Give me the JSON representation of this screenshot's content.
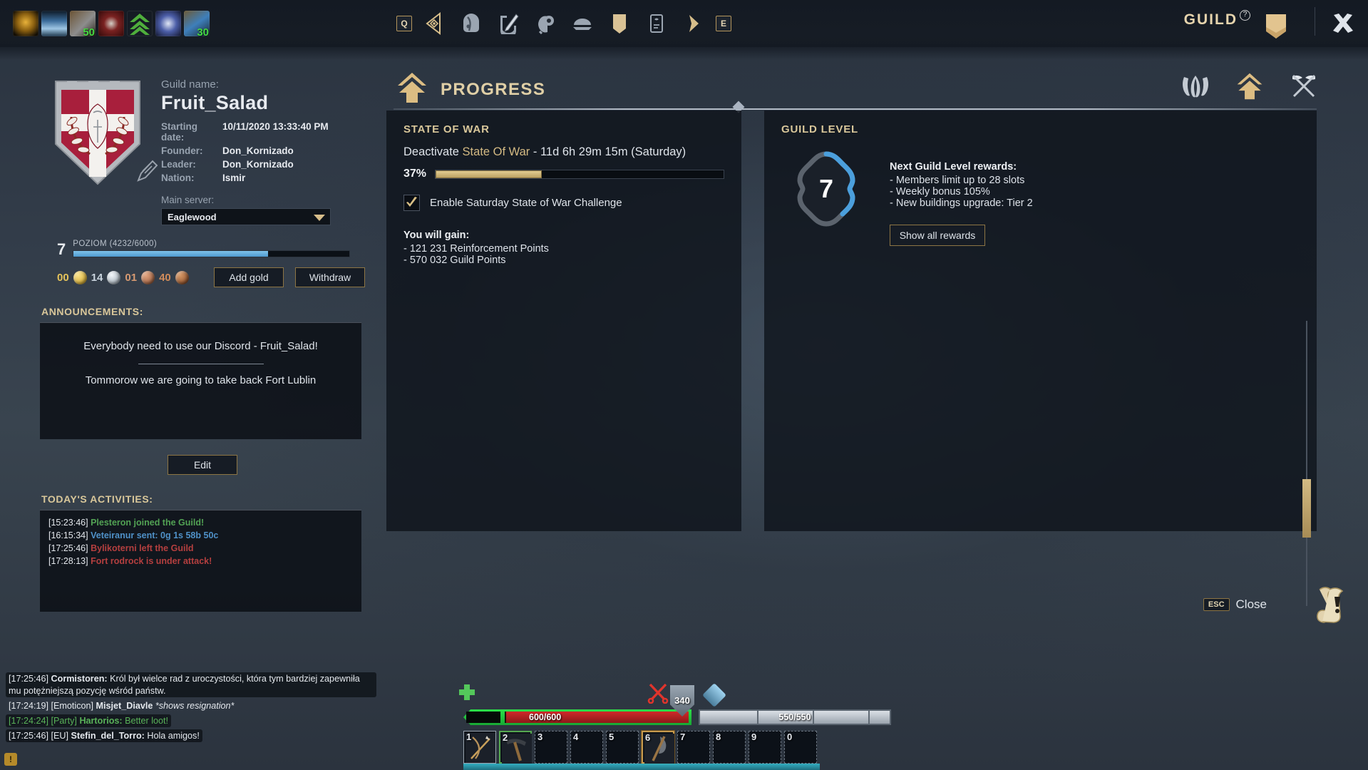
{
  "topbar": {
    "buffs": [
      {
        "name": "golden-leaf-buff",
        "count": ""
      },
      {
        "name": "frost-spirit-buff",
        "count": ""
      },
      {
        "name": "weapon-mastery-buff",
        "count": "50"
      },
      {
        "name": "blood-horn-buff",
        "count": ""
      },
      {
        "name": "double-chevron-buff",
        "count": ""
      },
      {
        "name": "dove-buff",
        "count": ""
      },
      {
        "name": "serpent-buff",
        "count": "30"
      }
    ],
    "quick_key": "Q",
    "toolbar_icons": [
      "quest-marker-icon",
      "backpack-icon",
      "equipment-icon",
      "skills-icon",
      "crafting-icon",
      "guild-banner-icon",
      "map-book-icon",
      "pen-icon"
    ],
    "emote_key": "E",
    "guild_label": "GUILD",
    "help_glyph": "?",
    "guild_crest_icon": "guild-shield-icon",
    "close_icon": "close-x-icon"
  },
  "guild": {
    "name_label": "Guild name:",
    "name": "Fruit_Salad",
    "fields": [
      {
        "key": "Starting date:",
        "value": "10/11/2020 13:33:40 PM"
      },
      {
        "key": "Founder:",
        "value": "Don_Kornizado"
      },
      {
        "key": "Leader:",
        "value": "Don_Kornizado"
      },
      {
        "key": "Nation:",
        "value": "Ismir"
      }
    ],
    "server_label": "Main server:",
    "server_value": "Eaglewood",
    "level_number": "7",
    "level_caption_label": "POZIOM",
    "level_caption_value": "(4232/6000)",
    "level_percent": 70.5,
    "currency": [
      {
        "name": "gold",
        "value": "00"
      },
      {
        "name": "silver",
        "value": "14"
      },
      {
        "name": "copper",
        "value": "01"
      },
      {
        "name": "bronze",
        "value": "40"
      }
    ],
    "add_gold_label": "Add gold",
    "withdraw_label": "Withdraw"
  },
  "announcements": {
    "title": "ANNOUNCEMENTS:",
    "line1": "Everybody need to use our Discord - Fruit_Salad!",
    "line2": "Tommorow we are going to take back Fort Lublin",
    "edit_label": "Edit"
  },
  "activities": {
    "title": "TODAY'S ACTIVITIES:",
    "items": [
      {
        "time": "[15:23:46]",
        "text": "Plesteron joined the Guild!",
        "color": "green"
      },
      {
        "time": "[16:15:34]",
        "text": "Veteiranur sent: 0g 1s 58b 50c",
        "color": "blue"
      },
      {
        "time": "[17:25:46]",
        "text": "Bylikoterni left the Guild",
        "color": "red"
      },
      {
        "time": "[17:28:13]",
        "text": "Fort rodrock is under attack!",
        "color": "red"
      }
    ]
  },
  "content": {
    "title": "PROGRESS",
    "header_icon": "progress-arrow-icon",
    "tabs": [
      {
        "name": "members",
        "icon": "helmets-icon",
        "active": false
      },
      {
        "name": "progress",
        "icon": "up-arrow-icon",
        "active": true
      },
      {
        "name": "wars",
        "icon": "crossed-flags-icon",
        "active": false
      }
    ]
  },
  "state_of_war": {
    "title": "STATE OF WAR",
    "line_prefix": "Deactivate ",
    "line_highlight": "State Of War",
    "line_suffix": " - 11d 6h 29m 15m (Saturday)",
    "percent_label": "37%",
    "percent_value": 37,
    "checkbox_checked": true,
    "checkbox_label": "Enable Saturday State of War Challenge",
    "gain_title": "You will gain:",
    "gain_items": [
      "- 121 231 Reinforcement Points",
      "- 570 032 Guild Points"
    ]
  },
  "guild_level": {
    "title": "GUILD LEVEL",
    "badge_number": "7",
    "badge_progress": 42,
    "rewards_title": "Next Guild Level rewards:",
    "rewards": [
      "- Members limit up to 28 slots",
      "- Weekly bonus 105%",
      "- New buildings upgrade: Tier 2"
    ],
    "show_all_label": "Show all rewards"
  },
  "chat": {
    "lines": [
      {
        "time": "[17:25:46]",
        "channel": "",
        "name": "Cormistoren:",
        "text": "Król był wielce rad z uroczystości, która tym bardziej zapewniła mu potężniejszą pozycję wśród państw.",
        "style": "normal",
        "bg": true
      },
      {
        "time": "[17:24:19]",
        "channel": "[Emoticon]",
        "name": "Misjet_Diavle",
        "text": "*shows resignation*",
        "style": "italic",
        "bg": false
      },
      {
        "time": "[17:24:24]",
        "channel": "[Party]",
        "name": "Hartorios:",
        "text": "Better loot!",
        "style": "green",
        "bg": true
      },
      {
        "time": "[17:25:46]",
        "channel": "[EU]",
        "name": "Stefin_del_Torro:",
        "text": "Hola amigos!",
        "style": "normal",
        "bg": true
      }
    ]
  },
  "hud": {
    "health": "600/600",
    "stamina": "550/550",
    "armor_value": "340",
    "slots": [
      {
        "key": "1",
        "item": "bow-and-arrow",
        "state": "filled"
      },
      {
        "key": "2",
        "item": "pickaxe",
        "state": "equipped"
      },
      {
        "key": "3",
        "item": "",
        "state": "empty"
      },
      {
        "key": "4",
        "item": "",
        "state": "empty"
      },
      {
        "key": "5",
        "item": "",
        "state": "empty"
      },
      {
        "key": "6",
        "item": "axe",
        "state": "active"
      },
      {
        "key": "7",
        "item": "",
        "state": "empty"
      },
      {
        "key": "8",
        "item": "",
        "state": "empty"
      },
      {
        "key": "9",
        "item": "",
        "state": "empty"
      },
      {
        "key": "0",
        "item": "",
        "state": "empty"
      }
    ]
  },
  "footer": {
    "esc_key": "ESC",
    "close_label": "Close",
    "notice_icon": "scroll-notice-icon"
  }
}
